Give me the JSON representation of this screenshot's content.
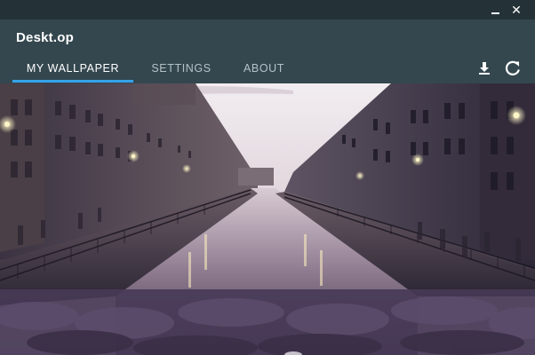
{
  "app": {
    "title": "Deskt.op"
  },
  "tabs": [
    {
      "label": "MY WALLPAPER",
      "active": true
    },
    {
      "label": "SETTINGS",
      "active": false
    },
    {
      "label": "ABOUT",
      "active": false
    }
  ],
  "window_controls": {
    "minimize_icon": "minimize-icon",
    "close_glyph": "✕"
  },
  "actions": {
    "download_icon": "download-icon",
    "refresh_icon": "refresh-icon"
  },
  "colors": {
    "titlebar": "#243238",
    "header": "#34474f",
    "tab_active_text": "#ffffff",
    "tab_inactive_text": "#b5c2c7",
    "tab_indicator": "#36a3ea"
  }
}
